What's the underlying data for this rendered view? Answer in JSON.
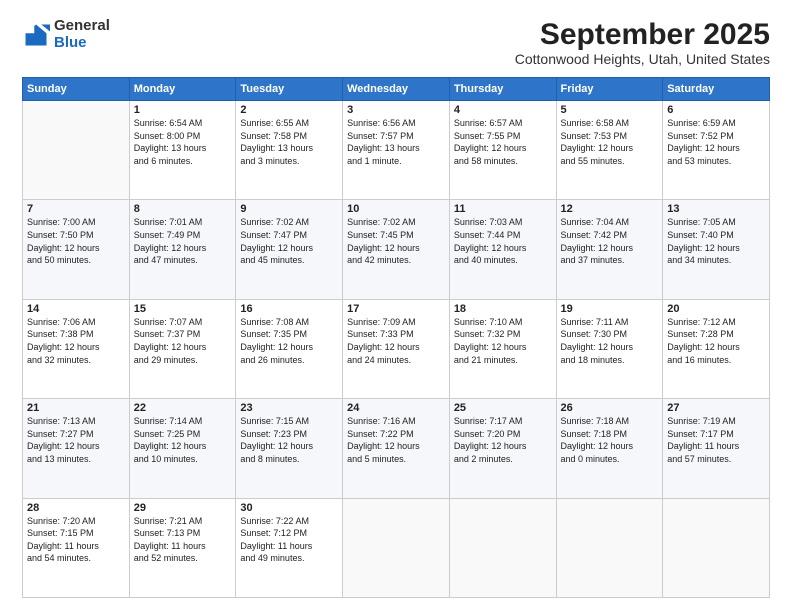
{
  "logo": {
    "general": "General",
    "blue": "Blue"
  },
  "header": {
    "month": "September 2025",
    "location": "Cottonwood Heights, Utah, United States"
  },
  "weekdays": [
    "Sunday",
    "Monday",
    "Tuesday",
    "Wednesday",
    "Thursday",
    "Friday",
    "Saturday"
  ],
  "weeks": [
    [
      {
        "day": "",
        "info": ""
      },
      {
        "day": "1",
        "info": "Sunrise: 6:54 AM\nSunset: 8:00 PM\nDaylight: 13 hours\nand 6 minutes."
      },
      {
        "day": "2",
        "info": "Sunrise: 6:55 AM\nSunset: 7:58 PM\nDaylight: 13 hours\nand 3 minutes."
      },
      {
        "day": "3",
        "info": "Sunrise: 6:56 AM\nSunset: 7:57 PM\nDaylight: 13 hours\nand 1 minute."
      },
      {
        "day": "4",
        "info": "Sunrise: 6:57 AM\nSunset: 7:55 PM\nDaylight: 12 hours\nand 58 minutes."
      },
      {
        "day": "5",
        "info": "Sunrise: 6:58 AM\nSunset: 7:53 PM\nDaylight: 12 hours\nand 55 minutes."
      },
      {
        "day": "6",
        "info": "Sunrise: 6:59 AM\nSunset: 7:52 PM\nDaylight: 12 hours\nand 53 minutes."
      }
    ],
    [
      {
        "day": "7",
        "info": "Sunrise: 7:00 AM\nSunset: 7:50 PM\nDaylight: 12 hours\nand 50 minutes."
      },
      {
        "day": "8",
        "info": "Sunrise: 7:01 AM\nSunset: 7:49 PM\nDaylight: 12 hours\nand 47 minutes."
      },
      {
        "day": "9",
        "info": "Sunrise: 7:02 AM\nSunset: 7:47 PM\nDaylight: 12 hours\nand 45 minutes."
      },
      {
        "day": "10",
        "info": "Sunrise: 7:02 AM\nSunset: 7:45 PM\nDaylight: 12 hours\nand 42 minutes."
      },
      {
        "day": "11",
        "info": "Sunrise: 7:03 AM\nSunset: 7:44 PM\nDaylight: 12 hours\nand 40 minutes."
      },
      {
        "day": "12",
        "info": "Sunrise: 7:04 AM\nSunset: 7:42 PM\nDaylight: 12 hours\nand 37 minutes."
      },
      {
        "day": "13",
        "info": "Sunrise: 7:05 AM\nSunset: 7:40 PM\nDaylight: 12 hours\nand 34 minutes."
      }
    ],
    [
      {
        "day": "14",
        "info": "Sunrise: 7:06 AM\nSunset: 7:38 PM\nDaylight: 12 hours\nand 32 minutes."
      },
      {
        "day": "15",
        "info": "Sunrise: 7:07 AM\nSunset: 7:37 PM\nDaylight: 12 hours\nand 29 minutes."
      },
      {
        "day": "16",
        "info": "Sunrise: 7:08 AM\nSunset: 7:35 PM\nDaylight: 12 hours\nand 26 minutes."
      },
      {
        "day": "17",
        "info": "Sunrise: 7:09 AM\nSunset: 7:33 PM\nDaylight: 12 hours\nand 24 minutes."
      },
      {
        "day": "18",
        "info": "Sunrise: 7:10 AM\nSunset: 7:32 PM\nDaylight: 12 hours\nand 21 minutes."
      },
      {
        "day": "19",
        "info": "Sunrise: 7:11 AM\nSunset: 7:30 PM\nDaylight: 12 hours\nand 18 minutes."
      },
      {
        "day": "20",
        "info": "Sunrise: 7:12 AM\nSunset: 7:28 PM\nDaylight: 12 hours\nand 16 minutes."
      }
    ],
    [
      {
        "day": "21",
        "info": "Sunrise: 7:13 AM\nSunset: 7:27 PM\nDaylight: 12 hours\nand 13 minutes."
      },
      {
        "day": "22",
        "info": "Sunrise: 7:14 AM\nSunset: 7:25 PM\nDaylight: 12 hours\nand 10 minutes."
      },
      {
        "day": "23",
        "info": "Sunrise: 7:15 AM\nSunset: 7:23 PM\nDaylight: 12 hours\nand 8 minutes."
      },
      {
        "day": "24",
        "info": "Sunrise: 7:16 AM\nSunset: 7:22 PM\nDaylight: 12 hours\nand 5 minutes."
      },
      {
        "day": "25",
        "info": "Sunrise: 7:17 AM\nSunset: 7:20 PM\nDaylight: 12 hours\nand 2 minutes."
      },
      {
        "day": "26",
        "info": "Sunrise: 7:18 AM\nSunset: 7:18 PM\nDaylight: 12 hours\nand 0 minutes."
      },
      {
        "day": "27",
        "info": "Sunrise: 7:19 AM\nSunset: 7:17 PM\nDaylight: 11 hours\nand 57 minutes."
      }
    ],
    [
      {
        "day": "28",
        "info": "Sunrise: 7:20 AM\nSunset: 7:15 PM\nDaylight: 11 hours\nand 54 minutes."
      },
      {
        "day": "29",
        "info": "Sunrise: 7:21 AM\nSunset: 7:13 PM\nDaylight: 11 hours\nand 52 minutes."
      },
      {
        "day": "30",
        "info": "Sunrise: 7:22 AM\nSunset: 7:12 PM\nDaylight: 11 hours\nand 49 minutes."
      },
      {
        "day": "",
        "info": ""
      },
      {
        "day": "",
        "info": ""
      },
      {
        "day": "",
        "info": ""
      },
      {
        "day": "",
        "info": ""
      }
    ]
  ]
}
